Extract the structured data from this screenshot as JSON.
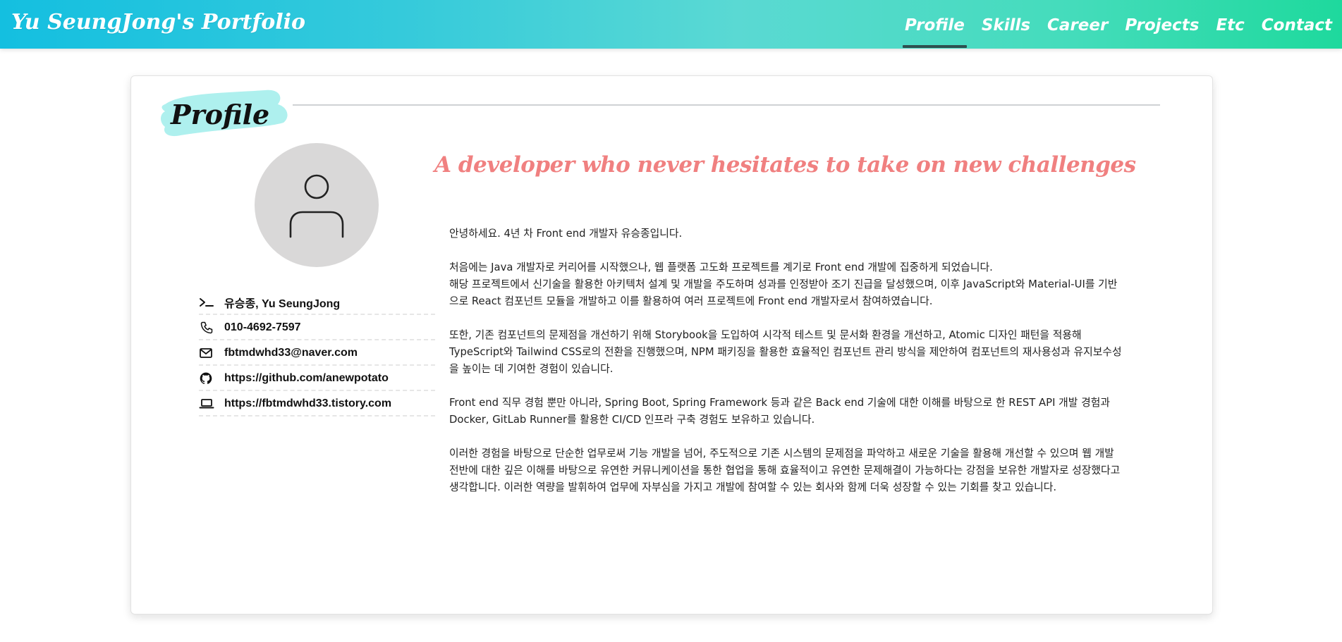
{
  "nav": {
    "brand": "Yu SeungJong's Portfolio",
    "items": [
      {
        "label": "Profile",
        "active": true
      },
      {
        "label": "Skills",
        "active": false
      },
      {
        "label": "Career",
        "active": false
      },
      {
        "label": "Projects",
        "active": false
      },
      {
        "label": "Etc",
        "active": false
      },
      {
        "label": "Contact",
        "active": false
      }
    ],
    "gradient": [
      "#14bfe0",
      "#1ed99d"
    ]
  },
  "section": {
    "title": "Profile",
    "highlight_color": "#aef0ee"
  },
  "profile": {
    "avatar_icon": "user-icon",
    "contacts": [
      {
        "icon": "terminal-icon",
        "text": "유승종, Yu SeungJong"
      },
      {
        "icon": "phone-icon",
        "text": "010-4692-7597"
      },
      {
        "icon": "mail-icon",
        "text": "fbtmdwhd33@naver.com"
      },
      {
        "icon": "github-icon",
        "text": "https://github.com/anewpotato"
      },
      {
        "icon": "laptop-icon",
        "text": "https://fbtmdwhd33.tistory.com"
      }
    ]
  },
  "about": {
    "tagline": "A developer who never hesitates to take on new challenges",
    "tagline_color": "#f08080",
    "paragraphs": [
      [
        "안녕하세요. 4년 차 Front end 개발자 유승종입니다."
      ],
      [
        "처음에는 Java 개발자로 커리어를 시작했으나, 웹 플랫폼 고도화 프로젝트를 계기로 Front end 개발에 집중하게 되었습니다.",
        "해당 프로젝트에서 신기술을 활용한 아키텍처 설계 및 개발을 주도하며 성과를 인정받아 조기 진급을 달성했으며, 이후 JavaScript와 Material-UI를 기반으로 React 컴포넌트 모듈을 개발하고 이를 활용하여 여러 프로젝트에 Front end 개발자로서 참여하였습니다."
      ],
      [
        "또한, 기존 컴포넌트의 문제점을 개선하기 위해 Storybook을 도입하여 시각적 테스트 및 문서화 환경을 개선하고, Atomic 디자인 패턴을 적용해 TypeScript와 Tailwind CSS로의 전환을 진행했으며, NPM 패키징을 활용한 효율적인 컴포넌트 관리 방식을 제안하여 컴포넌트의 재사용성과 유지보수성을 높이는 데 기여한 경험이 있습니다."
      ],
      [
        "Front end 직무 경험 뿐만 아니라, Spring Boot, Spring Framework 등과 같은 Back end 기술에 대한 이해를 바탕으로 한 REST API 개발 경험과 Docker, GitLab Runner를 활용한 CI/CD 인프라 구축 경험도 보유하고 있습니다."
      ],
      [
        "이러한 경험을 바탕으로 단순한 업무로써 기능 개발을 넘어, 주도적으로 기존 시스템의 문제점을 파악하고 새로운 기술을 활용해 개선할 수 있으며 웹 개발 전반에 대한 깊은 이해를 바탕으로 유연한 커뮤니케이션을 통한 협업을 통해 효율적이고 유연한 문제해결이 가능하다는 강점을 보유한 개발자로 성장했다고 생각합니다. 이러한 역량을 발휘하여 업무에 자부심을 가지고 개발에 참여할 수 있는 회사와 함께 더욱 성장할 수 있는 기회를 찾고 있습니다."
      ]
    ]
  }
}
